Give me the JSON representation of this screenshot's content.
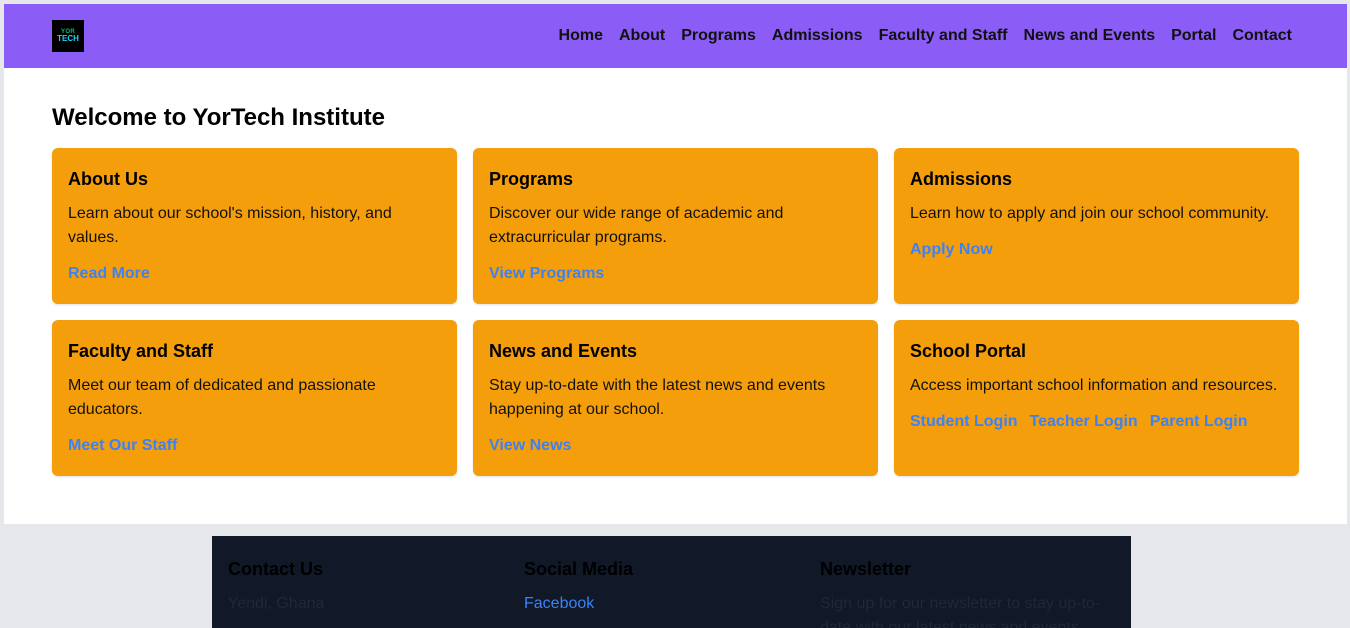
{
  "logo": {
    "line1": "YOR",
    "line2": "TECH"
  },
  "nav": {
    "items": [
      "Home",
      "About",
      "Programs",
      "Admissions",
      "Faculty and Staff",
      "News and Events",
      "Portal",
      "Contact"
    ]
  },
  "main": {
    "title": "Welcome to YorTech Institute",
    "cards": [
      {
        "title": "About Us",
        "text": "Learn about our school's mission, history, and values.",
        "links": [
          "Read More"
        ]
      },
      {
        "title": "Programs",
        "text": "Discover our wide range of academic and extracurricular programs.",
        "links": [
          "View Programs"
        ]
      },
      {
        "title": "Admissions",
        "text": "Learn how to apply and join our school community.",
        "links": [
          "Apply Now"
        ]
      },
      {
        "title": "Faculty and Staff",
        "text": "Meet our team of dedicated and passionate educators.",
        "links": [
          "Meet Our Staff"
        ]
      },
      {
        "title": "News and Events",
        "text": "Stay up-to-date with the latest news and events happening at our school.",
        "links": [
          "View News"
        ]
      },
      {
        "title": "School Portal",
        "text": "Access important school information and resources.",
        "links": [
          "Student Login",
          "Teacher Login",
          "Parent Login"
        ]
      }
    ]
  },
  "footer": {
    "contact": {
      "title": "Contact Us",
      "address": "Yendi, Ghana"
    },
    "social": {
      "title": "Social Media",
      "link": "Facebook"
    },
    "newsletter": {
      "title": "Newsletter",
      "text": "Sign up for our newsletter to stay up-to-date with our latest news and events."
    }
  },
  "colors": {
    "header": "#8b5cf6",
    "card": "#f59e0b",
    "link": "#3b82f6",
    "footer": "#111827"
  }
}
